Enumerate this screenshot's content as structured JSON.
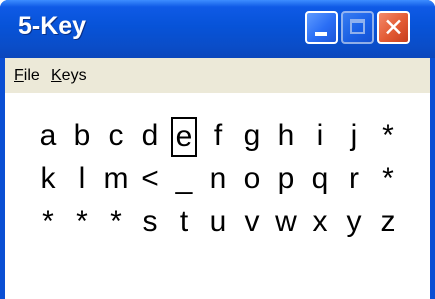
{
  "window": {
    "title": "5-Key"
  },
  "titlebar_buttons": [
    "minimize-icon",
    "maximize-icon",
    "close-icon"
  ],
  "menu": [
    {
      "label": "File",
      "accel": "F",
      "rest": "ile"
    },
    {
      "label": "Keys",
      "accel": "K",
      "rest": "eys"
    }
  ],
  "keyboard": {
    "selected": "e",
    "rows": [
      [
        "a",
        "b",
        "c",
        "d",
        "e",
        "f",
        "g",
        "h",
        "i",
        "j",
        "*"
      ],
      [
        "k",
        "l",
        "m",
        "<",
        "_",
        "n",
        "o",
        "p",
        "q",
        "r",
        "*"
      ],
      [
        "*",
        "*",
        "*",
        "s",
        "t",
        "u",
        "v",
        "w",
        "x",
        "y",
        "z"
      ]
    ]
  },
  "colors": {
    "titlebar": "#0a4fd4",
    "menubar": "#ece9d8",
    "close": "#e25a33"
  }
}
